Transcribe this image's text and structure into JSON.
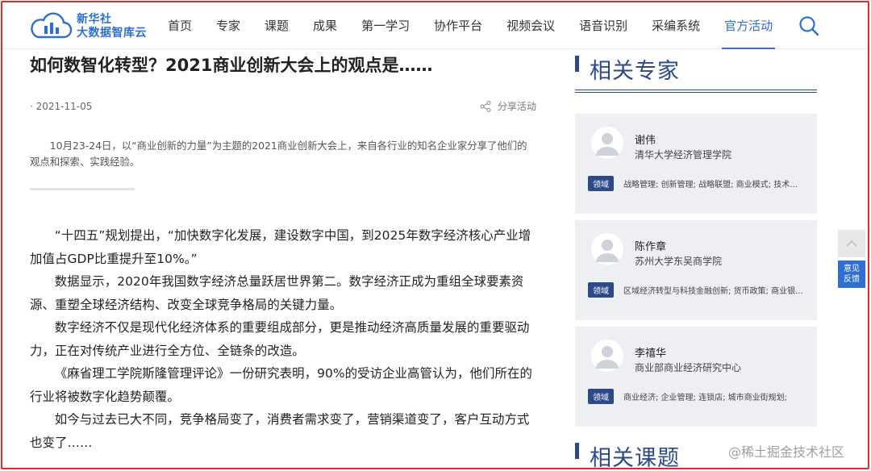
{
  "logo": {
    "line1": "新华社",
    "line2": "大数据智库云"
  },
  "nav": [
    "首页",
    "专家",
    "课题",
    "成果",
    "第一学习",
    "协作平台",
    "视频会议",
    "语音识别",
    "采编系统",
    "官方活动"
  ],
  "nav_active_index": 9,
  "article": {
    "title": "如何数智化转型？2021商业创新大会上的观点是……",
    "date": "· 2021-11-05",
    "share_label": "分享活动",
    "summary": "10月23-24日，以“商业创新的力量”为主题的2021商业创新大会上，来自各行业的知名企业家分享了他们的观点和探索、实践经验。",
    "paragraphs": [
      "“十四五”规划提出，“加快数字化发展，建设数字中国，到2025年数字经济核心产业增加值占GDP比重提升至10%。”",
      "数据显示，2020年我国数字经济总量跃居世界第二。数字经济正成为重组全球要素资源、重塑全球经济结构、改变全球竞争格局的关键力量。",
      "数字经济不仅是现代化经济体系的重要组成部分，更是推动经济高质量发展的重要驱动力，正在对传统产业进行全方位、全链条的改造。",
      "《麻省理工学院斯隆管理评论》一份研究表明，90%的受访企业高管认为，他们所在的行业将被数字化趋势颠覆。",
      "如今与过去已大不同，竞争格局变了，消费者需求变了，营销渠道变了，客户互动方式也变了……"
    ]
  },
  "sidebar": {
    "experts_title": "相关专家",
    "topics_title": "相关课题",
    "field_tag": "领域",
    "experts": [
      {
        "name": "谢伟",
        "org": "清华大学经济管理学院",
        "fields": "战略管理; 创新管理; 战略联盟; 商业模式; 技术驱..."
      },
      {
        "name": "陈作章",
        "org": "苏州大学东吴商学院",
        "fields": "区域经济转型与科技金融创新; 货币政策; 商业银..."
      },
      {
        "name": "李禧华",
        "org": "商业部商业经济研究中心",
        "fields": "商业经济; 企业管理; 连锁店; 城市商业街规划;"
      }
    ]
  },
  "float": {
    "feedback_line1": "意见",
    "feedback_line2": "反馈"
  },
  "watermark": "@稀土掘金技术社区",
  "colors": {
    "accent": "#2f6fd1",
    "sidebar_navy": "#2c4a8a",
    "frame_red": "#e02b2b",
    "card_bg": "#eeeff2"
  }
}
